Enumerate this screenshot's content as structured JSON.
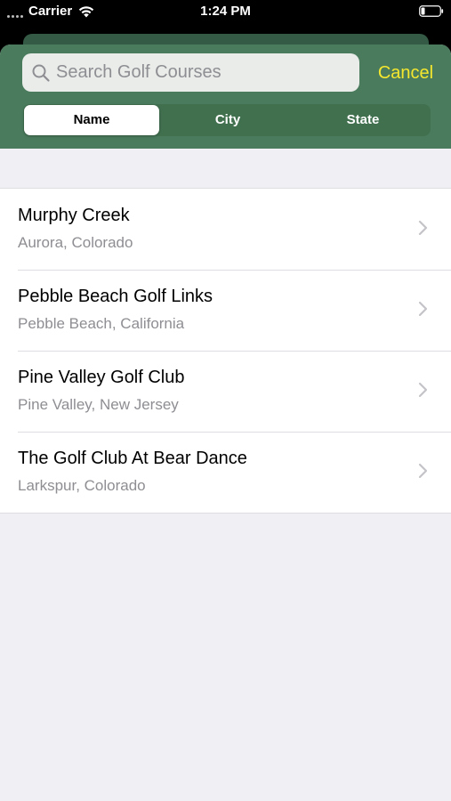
{
  "status_bar": {
    "carrier": "Carrier",
    "time": "1:24 PM",
    "icons": [
      "signal-dots-icon",
      "wifi-icon",
      "battery-icon"
    ]
  },
  "search": {
    "placeholder": "Search Golf Courses",
    "value": "",
    "cancel_label": "Cancel"
  },
  "scope": {
    "options": [
      "Name",
      "City",
      "State"
    ],
    "selected": "Name"
  },
  "courses": [
    {
      "name": "Murphy Creek",
      "location": "Aurora, Colorado"
    },
    {
      "name": "Pebble Beach Golf Links",
      "location": "Pebble Beach, California"
    },
    {
      "name": "Pine Valley Golf Club",
      "location": "Pine Valley, New Jersey"
    },
    {
      "name": "The Golf Club At Bear Dance",
      "location": "Larkspur, Colorado"
    }
  ],
  "colors": {
    "header": "#4a7b5d",
    "accent": "#f5e72e",
    "background": "#efeff4"
  }
}
